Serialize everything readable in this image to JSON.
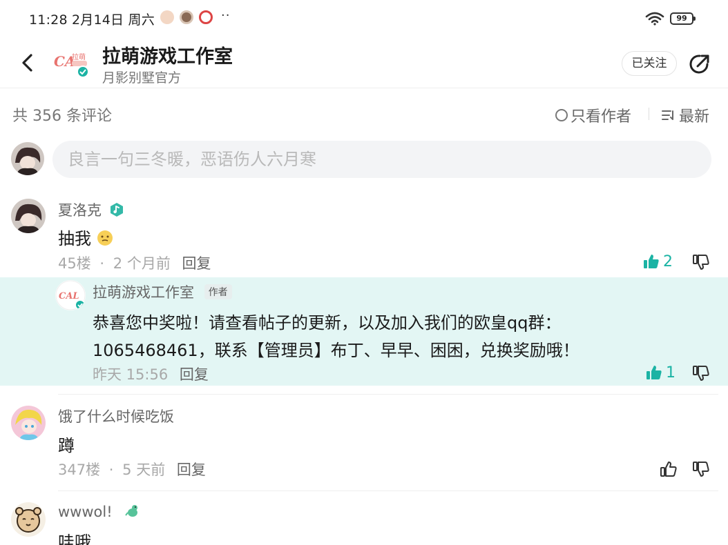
{
  "status_bar": {
    "time": "11:28 2月14日 周六",
    "more": "··",
    "battery": "99"
  },
  "header": {
    "title": "拉萌游戏工作室",
    "subtitle": "月影别墅官方",
    "follow_label": "已关注",
    "logo_text": "拉萌",
    "brand_color": "#1bb3a4"
  },
  "comments_bar": {
    "count_text": "共 356 条评论",
    "only_author_label": "只看作者",
    "sort_label": "最新"
  },
  "input": {
    "placeholder": "良言一句三冬暖，恶语伤人六月寒"
  },
  "comments": [
    {
      "user": "夏洛克",
      "text": "抽我",
      "floor": "45楼",
      "time": "2 个月前",
      "reply_label": "回复",
      "likes": "2",
      "liked": true,
      "reply": {
        "user": "拉萌游戏工作室",
        "badge": "作者",
        "text_line1": "恭喜您中奖啦！请查看帖子的更新，以及加入我们的欧皇qq群：",
        "text_line2": "1065468461，联系【管理员】布丁、早早、困困，兑换奖励哦！",
        "time": "昨天 15:56",
        "reply_label": "回复",
        "likes": "1"
      }
    },
    {
      "user": "饿了什么时候吃饭",
      "text": "蹲",
      "floor": "347楼",
      "time": "5 天前",
      "reply_label": "回复"
    },
    {
      "user": "wwwol!",
      "text": "哇哦"
    }
  ]
}
